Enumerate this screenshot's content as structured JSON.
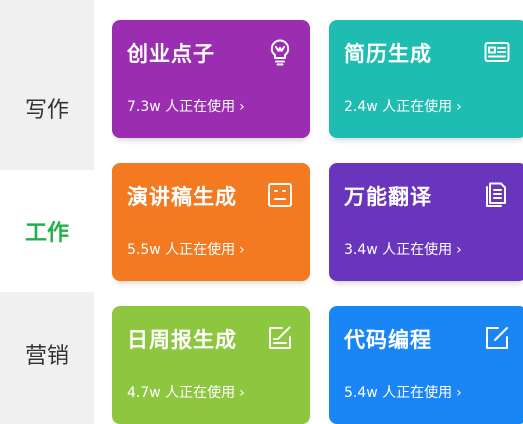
{
  "sidebar": {
    "items": [
      {
        "label": "写作"
      },
      {
        "label": "工作"
      },
      {
        "label": "营销"
      }
    ]
  },
  "cards": [
    {
      "title": "创业点子",
      "usage": "7.3w 人正在使用",
      "color": "#9b2db1",
      "icon": "lightbulb-icon"
    },
    {
      "title": "简历生成",
      "usage": "2.4w 人正在使用",
      "color": "#1fbdb1",
      "icon": "id-card-icon"
    },
    {
      "title": "演讲稿生成",
      "usage": "5.5w 人正在使用",
      "color": "#f37a20",
      "icon": "robot-face-icon"
    },
    {
      "title": "万能翻译",
      "usage": "3.4w 人正在使用",
      "color": "#6a35bd",
      "icon": "document-icon"
    },
    {
      "title": "日周报生成",
      "usage": "4.7w 人正在使用",
      "color": "#8dc63f",
      "icon": "edit-note-icon"
    },
    {
      "title": "代码编程",
      "usage": "5.4w 人正在使用",
      "color": "#1a86f5",
      "icon": "edit-square-icon"
    }
  ],
  "colors": {
    "sidebar_bg": "#f0f0f0",
    "sidebar_active_text": "#22b04b",
    "sidebar_text": "#333333"
  }
}
